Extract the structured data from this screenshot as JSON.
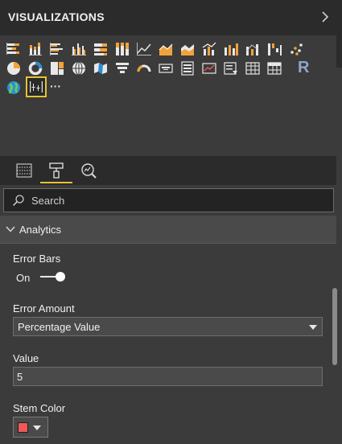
{
  "header": {
    "title": "VISUALIZATIONS",
    "expand_icon": "chevron-right-icon"
  },
  "visual_gallery": {
    "items": [
      {
        "icon": "stacked-bar-chart-icon"
      },
      {
        "icon": "stacked-column-chart-icon"
      },
      {
        "icon": "clustered-bar-chart-icon"
      },
      {
        "icon": "clustered-column-chart-icon"
      },
      {
        "icon": "100-percent-stacked-bar-chart-icon"
      },
      {
        "icon": "100-percent-stacked-column-chart-icon"
      },
      {
        "icon": "line-chart-icon"
      },
      {
        "icon": "area-chart-icon"
      },
      {
        "icon": "stacked-area-chart-icon"
      },
      {
        "icon": "line-and-stacked-column-chart-icon"
      },
      {
        "icon": "line-and-clustered-column-chart-icon"
      },
      {
        "icon": "ribbon-chart-icon"
      },
      {
        "icon": "waterfall-chart-icon"
      },
      {
        "icon": "scatter-chart-icon"
      },
      {
        "icon": "pie-chart-icon"
      },
      {
        "icon": "donut-chart-icon"
      },
      {
        "icon": "treemap-icon"
      },
      {
        "icon": "map-icon"
      },
      {
        "icon": "filled-map-icon"
      },
      {
        "icon": "funnel-icon"
      },
      {
        "icon": "gauge-icon"
      },
      {
        "icon": "card-icon"
      },
      {
        "icon": "multi-row-card-icon"
      },
      {
        "icon": "kpi-icon"
      },
      {
        "icon": "slicer-icon"
      },
      {
        "icon": "table-icon"
      },
      {
        "icon": "matrix-icon"
      },
      {
        "icon": "r-script-visual-icon",
        "text": "R"
      },
      {
        "icon": "globe-map-icon"
      },
      {
        "icon": "error-bar-chart-icon",
        "selected": true
      },
      {
        "icon": "more-options-icon",
        "text": "···"
      }
    ]
  },
  "pane_tabs": [
    {
      "icon": "fields-icon",
      "active": false
    },
    {
      "icon": "format-paint-roller-icon",
      "active": true
    },
    {
      "icon": "analytics-magnifier-icon",
      "active": false
    }
  ],
  "search": {
    "placeholder": "Search"
  },
  "section": {
    "title": "Analytics",
    "expanded": true
  },
  "error_bars": {
    "label": "Error Bars",
    "state_text": "On",
    "enabled": true
  },
  "error_amount": {
    "label": "Error Amount",
    "selected": "Percentage Value"
  },
  "value_field": {
    "label": "Value",
    "value": "5"
  },
  "stem_color": {
    "label": "Stem Color",
    "color": "#f1585a"
  },
  "colors": {
    "accent": "#e9c231",
    "panel": "#3b3b3b",
    "header": "#2b2b2b"
  }
}
